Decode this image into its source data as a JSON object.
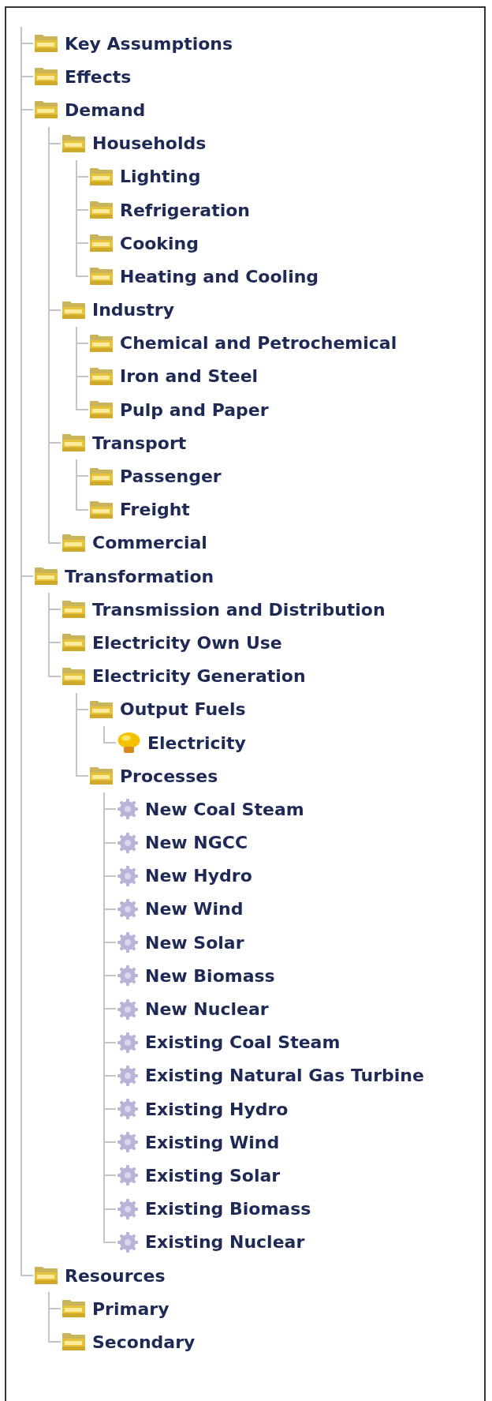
{
  "tree": [
    {
      "label": "Key Assumptions",
      "kind": "folder"
    },
    {
      "label": "Effects",
      "kind": "folder"
    },
    {
      "label": "Demand",
      "kind": "folder",
      "children": [
        {
          "label": "Households",
          "kind": "folder",
          "children": [
            {
              "label": "Lighting",
              "kind": "folder"
            },
            {
              "label": "Refrigeration",
              "kind": "folder"
            },
            {
              "label": "Cooking",
              "kind": "folder"
            },
            {
              "label": "Heating and Cooling",
              "kind": "folder"
            }
          ]
        },
        {
          "label": "Industry",
          "kind": "folder",
          "children": [
            {
              "label": "Chemical and Petrochemical",
              "kind": "folder"
            },
            {
              "label": "Iron and Steel",
              "kind": "folder"
            },
            {
              "label": "Pulp and Paper",
              "kind": "folder"
            }
          ]
        },
        {
          "label": "Transport",
          "kind": "folder",
          "children": [
            {
              "label": "Passenger",
              "kind": "folder"
            },
            {
              "label": "Freight",
              "kind": "folder"
            }
          ]
        },
        {
          "label": "Commercial",
          "kind": "folder"
        }
      ]
    },
    {
      "label": "Transformation",
      "kind": "folder",
      "children": [
        {
          "label": "Transmission and Distribution",
          "kind": "folder"
        },
        {
          "label": "Electricity Own Use",
          "kind": "folder"
        },
        {
          "label": "Electricity Generation",
          "kind": "folder",
          "children": [
            {
              "label": "Output Fuels",
              "kind": "folder",
              "children": [
                {
                  "label": "Electricity",
                  "kind": "fuel"
                }
              ]
            },
            {
              "label": "Processes",
              "kind": "folder",
              "children": [
                {
                  "label": "New Coal Steam",
                  "kind": "process"
                },
                {
                  "label": "New NGCC",
                  "kind": "process"
                },
                {
                  "label": "New Hydro",
                  "kind": "process"
                },
                {
                  "label": "New Wind",
                  "kind": "process"
                },
                {
                  "label": "New Solar",
                  "kind": "process"
                },
                {
                  "label": "New Biomass",
                  "kind": "process"
                },
                {
                  "label": "New Nuclear",
                  "kind": "process"
                },
                {
                  "label": "Existing Coal Steam",
                  "kind": "process"
                },
                {
                  "label": "Existing Natural Gas Turbine",
                  "kind": "process"
                },
                {
                  "label": "Existing Hydro",
                  "kind": "process"
                },
                {
                  "label": "Existing Wind",
                  "kind": "process"
                },
                {
                  "label": "Existing Solar",
                  "kind": "process"
                },
                {
                  "label": "Existing Biomass",
                  "kind": "process"
                },
                {
                  "label": "Existing Nuclear",
                  "kind": "process"
                }
              ]
            }
          ]
        }
      ]
    },
    {
      "label": "Resources",
      "kind": "folder",
      "children": [
        {
          "label": "Primary",
          "kind": "folder"
        },
        {
          "label": "Secondary",
          "kind": "folder"
        }
      ]
    }
  ]
}
